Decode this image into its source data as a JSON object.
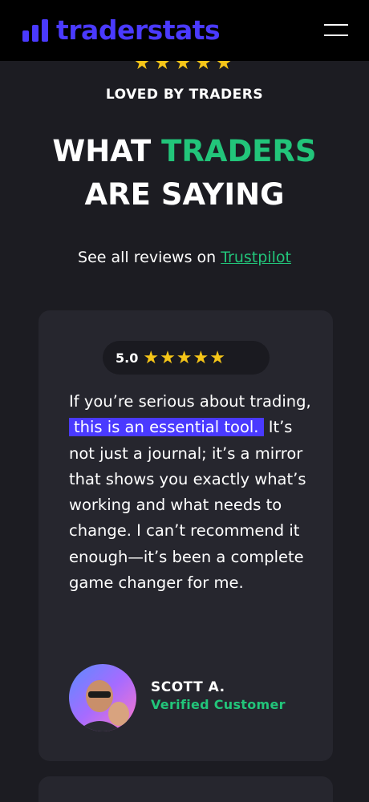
{
  "brand": {
    "name": "traderstats",
    "color": "#4a3aff"
  },
  "hero": {
    "top_stars": "★★★★★",
    "eyebrow": "LOVED BY TRADERS",
    "heading_part1": "WHAT ",
    "heading_accent": "TRADERS",
    "heading_part2": "ARE SAYING",
    "subline_text": "See all reviews on ",
    "subline_link": "Trustpilot"
  },
  "review": {
    "rating": "5.0",
    "stars": "★★★★★",
    "quote_before": "If you’re serious about trading, ",
    "quote_highlight": "this is an essential tool.",
    "quote_after": " It’s not just a journal; it’s a mirror that shows you exactly what’s working and what needs to change. I can’t recommend it enough—it’s been a complete game changer for me.",
    "author_name": "SCOTT A.",
    "author_tag": "Verified Customer"
  },
  "colors": {
    "accent_green": "#22c57a",
    "star": "#f5c518",
    "highlight": "#4a3aff"
  }
}
